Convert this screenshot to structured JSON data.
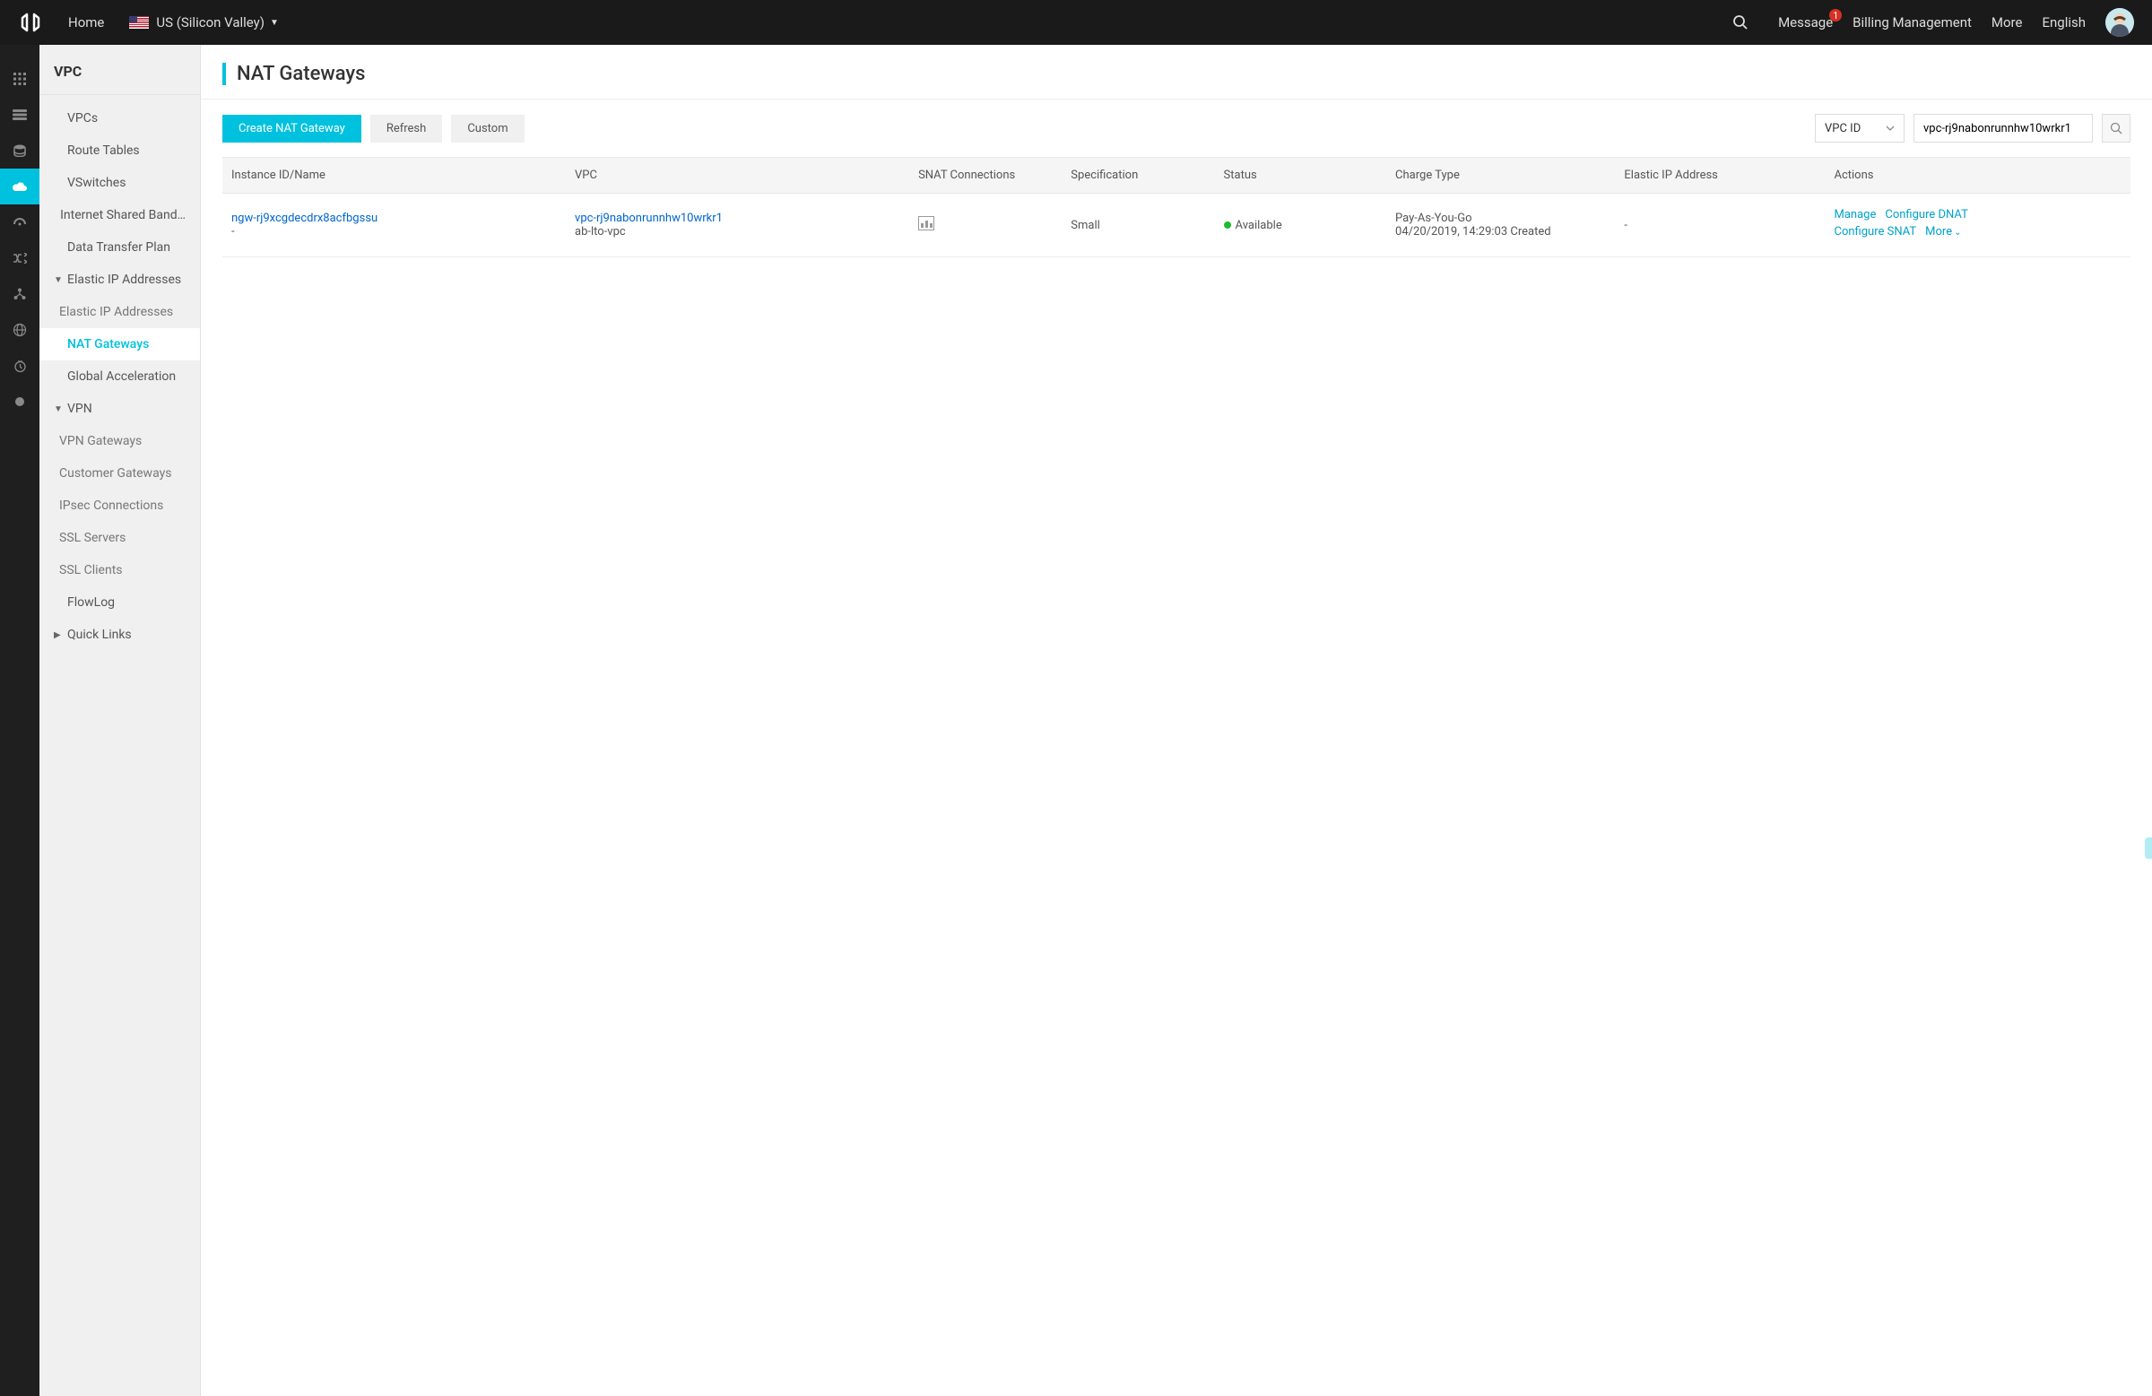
{
  "header": {
    "home": "Home",
    "region": "US (Silicon Valley)",
    "message": "Message",
    "message_badge": "1",
    "billing": "Billing Management",
    "more": "More",
    "language": "English"
  },
  "sidebar": {
    "title": "VPC",
    "items": [
      {
        "label": "VPCs"
      },
      {
        "label": "Route Tables"
      },
      {
        "label": "VSwitches"
      },
      {
        "label": "Internet Shared Band…"
      },
      {
        "label": "Data Transfer Plan"
      },
      {
        "label": "Elastic IP Addresses",
        "expanded": true
      },
      {
        "label": "Elastic IP Addresses",
        "sub": true
      },
      {
        "label": "NAT Gateways",
        "active": true
      },
      {
        "label": "Global Acceleration"
      },
      {
        "label": "VPN",
        "expanded": true
      },
      {
        "label": "VPN Gateways",
        "sub": true
      },
      {
        "label": "Customer Gateways",
        "sub": true
      },
      {
        "label": "IPsec Connections",
        "sub": true
      },
      {
        "label": "SSL Servers",
        "sub": true
      },
      {
        "label": "SSL Clients",
        "sub": true
      },
      {
        "label": "FlowLog"
      },
      {
        "label": "Quick Links",
        "collapsed": true
      }
    ]
  },
  "page": {
    "title": "NAT Gateways"
  },
  "toolbar": {
    "create": "Create NAT Gateway",
    "refresh": "Refresh",
    "custom": "Custom",
    "filter_type": "VPC ID",
    "filter_value": "vpc-rj9nabonrunnhw10wrkr1"
  },
  "table": {
    "headers": {
      "instance": "Instance ID/Name",
      "vpc": "VPC",
      "snat": "SNAT Connections",
      "spec": "Specification",
      "status": "Status",
      "charge": "Charge Type",
      "eip": "Elastic IP Address",
      "actions": "Actions"
    },
    "row": {
      "instance_id": "ngw-rj9xcgdecdrx8acfbgssu",
      "instance_name": "-",
      "vpc_id": "vpc-rj9nabonrunnhw10wrkr1",
      "vpc_name": "ab-lto-vpc",
      "spec": "Small",
      "status": "Available",
      "charge_type": "Pay-As-You-Go",
      "charge_time": "04/20/2019, 14:29:03 Created",
      "eip": "-",
      "action_manage": "Manage",
      "action_dnat": "Configure DNAT",
      "action_snat": "Configure SNAT",
      "action_more": "More"
    }
  }
}
